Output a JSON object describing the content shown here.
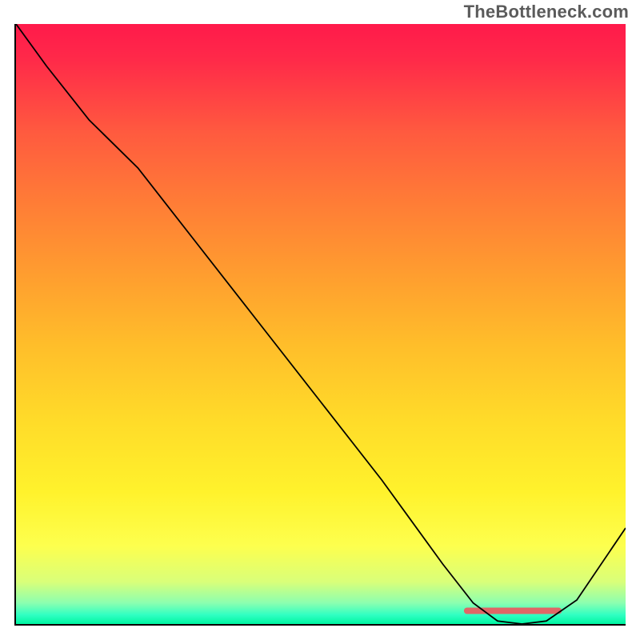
{
  "watermark": "TheBottleneck.com",
  "chart_data": {
    "type": "line",
    "title": "",
    "xlabel": "",
    "ylabel": "",
    "xlim": [
      0,
      100
    ],
    "ylim": [
      0,
      100
    ],
    "grid": false,
    "legend": false,
    "background_gradient": {
      "stops": [
        {
          "offset": 0.0,
          "color": "#ff1a4b"
        },
        {
          "offset": 0.06,
          "color": "#ff2a49"
        },
        {
          "offset": 0.18,
          "color": "#ff5a3f"
        },
        {
          "offset": 0.3,
          "color": "#ff7d36"
        },
        {
          "offset": 0.42,
          "color": "#ff9e2f"
        },
        {
          "offset": 0.54,
          "color": "#ffbf2a"
        },
        {
          "offset": 0.66,
          "color": "#ffdb29"
        },
        {
          "offset": 0.78,
          "color": "#fff22c"
        },
        {
          "offset": 0.87,
          "color": "#fdff4e"
        },
        {
          "offset": 0.93,
          "color": "#d9ff7a"
        },
        {
          "offset": 0.965,
          "color": "#8bffb0"
        },
        {
          "offset": 0.985,
          "color": "#2fffc2"
        },
        {
          "offset": 1.0,
          "color": "#00f5a0"
        }
      ]
    },
    "series": [
      {
        "name": "bottleneck-curve",
        "color": "#000000",
        "x": [
          0,
          5,
          12,
          20,
          30,
          40,
          50,
          60,
          70,
          75,
          79,
          83,
          87,
          92,
          100
        ],
        "values": [
          100,
          93,
          84,
          76,
          63,
          50,
          37,
          24,
          10,
          3.5,
          0.5,
          0.0,
          0.5,
          4,
          16
        ]
      }
    ],
    "annotations": [
      {
        "name": "optimal-range-marker",
        "type": "segment",
        "color": "#e06666",
        "x0": 74,
        "y0": 2.2,
        "x1": 89,
        "y1": 2.2,
        "width": 8
      }
    ]
  }
}
